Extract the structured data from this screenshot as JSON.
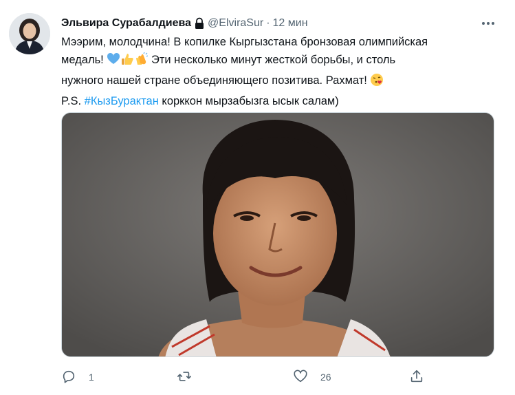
{
  "tweet": {
    "author_name": "Эльвира Сурабалдиева",
    "handle": "@ElviraSur",
    "separator": "·",
    "time": "12 мин",
    "lines": {
      "l1": "Мээрим, молодчина! В копилке Кыргызстана бронзовая олимпийская",
      "l2_a": "медаль!",
      "l2_b": "Эти несколько минут жесткой борьбы, и столь",
      "l3": "нужного нашей стране объединяющего позитива. Рахмат!",
      "l4_a": "P.S.",
      "l4_hashtag": "#КызБурактан",
      "l4_b": "корккон мырзабызга ысык салам)"
    }
  },
  "actions": {
    "reply_count": "1",
    "retweet_count": "",
    "like_count": "26"
  },
  "icons": {
    "lock": "lock-icon",
    "more": "more-icon",
    "reply": "reply-icon",
    "retweet": "retweet-icon",
    "like": "heart-icon",
    "share": "share-icon"
  },
  "colors": {
    "hashtag": "#1d9bf0",
    "secondary_text": "#536471",
    "photo_background": "#6a6866"
  }
}
